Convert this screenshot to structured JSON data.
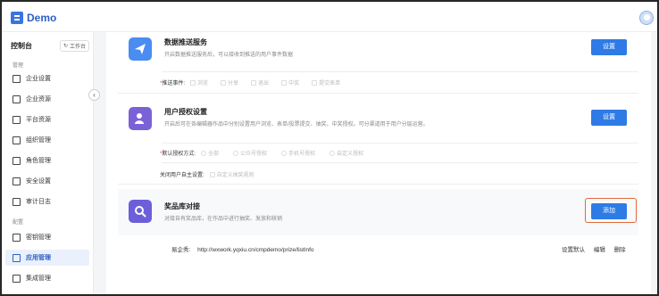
{
  "app": {
    "logo_text": "Demo"
  },
  "sidebar": {
    "title": "控制台",
    "workbench_label": "工作台",
    "section_manage": "管理",
    "section_config": "配置",
    "items_manage": [
      {
        "label": "企业设置",
        "icon": "building-icon"
      },
      {
        "label": "企业资源",
        "icon": "folder-icon"
      },
      {
        "label": "平台资源",
        "icon": "folder-open-icon"
      },
      {
        "label": "组织管理",
        "icon": "users-icon"
      },
      {
        "label": "角色管理",
        "icon": "id-card-icon"
      },
      {
        "label": "安全设置",
        "icon": "shield-icon"
      },
      {
        "label": "审计日志",
        "icon": "log-icon"
      }
    ],
    "items_config": [
      {
        "label": "密钥管理",
        "icon": "key-icon"
      },
      {
        "label": "应用管理",
        "icon": "apps-icon",
        "active": true
      },
      {
        "label": "集成管理",
        "icon": "layers-icon"
      }
    ]
  },
  "data_push": {
    "title": "数据推送服务",
    "desc": "开启数据推送服务后，可以接收到推送的用户事件数据",
    "button": "设置",
    "events_label": "推送事件:",
    "events": [
      "浏览",
      "分享",
      "退出",
      "中奖",
      "提交表单"
    ]
  },
  "user_auth": {
    "title": "用户授权设置",
    "desc": "开启后可在各编辑器作品中分别设置用户浏览、表单/投票提交、抽奖、中奖授权。可分渠道用于用户分层运营。",
    "button": "设置",
    "default_label": "默认授权方式:",
    "default_options": [
      "全部",
      "公众号授权",
      "手机号授权",
      "自定义授权"
    ],
    "close_label": "关闭用户自主设置:",
    "close_option": "自定义抽奖规则"
  },
  "prize": {
    "title": "奖品库对接",
    "desc": "对接自有奖品库，在作品中进行抽奖、发放和核销",
    "button": "添加",
    "entry_name": "易企秀:",
    "entry_url": "http://wxwork.yqxiu.cn/cmpdemo/prize/listInfo",
    "actions": [
      "设置默认",
      "编辑",
      "删除"
    ]
  },
  "colors": {
    "primary": "#2f7be6",
    "highlight": "#e2693a"
  }
}
